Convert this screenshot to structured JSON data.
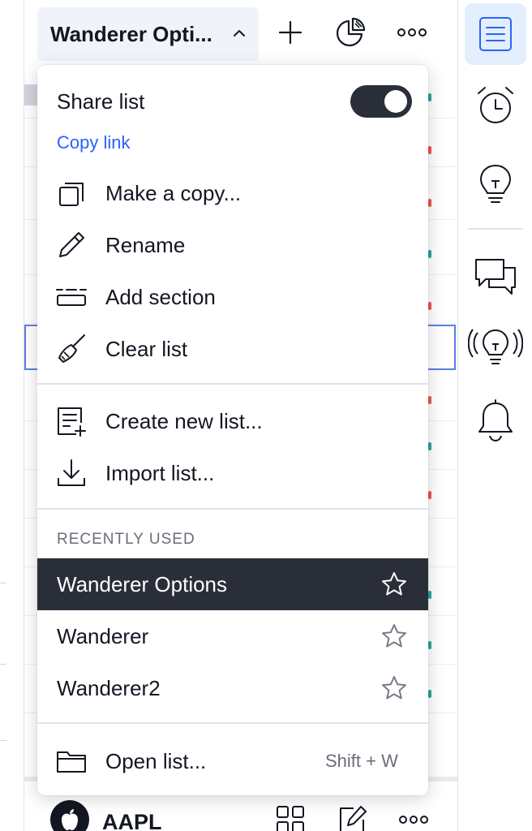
{
  "watchlist": {
    "title": "Wanderer Opti...",
    "symbol": "AAPL"
  },
  "menu": {
    "share_label": "Share list",
    "share_enabled": true,
    "copy_link": "Copy link",
    "items": [
      {
        "label": "Make a copy...",
        "icon": "copy-icon"
      },
      {
        "label": "Rename",
        "icon": "pencil-icon"
      },
      {
        "label": "Add section",
        "icon": "section-icon"
      },
      {
        "label": "Clear list",
        "icon": "broom-icon"
      }
    ],
    "items2": [
      {
        "label": "Create new list...",
        "icon": "new-list-icon"
      },
      {
        "label": "Import list...",
        "icon": "import-icon"
      }
    ],
    "recent_title": "RECENTLY USED",
    "recent": [
      {
        "label": "Wanderer Options",
        "selected": true
      },
      {
        "label": "Wanderer",
        "selected": false
      },
      {
        "label": "Wanderer2",
        "selected": false
      }
    ],
    "open_list": {
      "label": "Open list...",
      "shortcut": "Shift + W",
      "icon": "folder-icon"
    }
  },
  "right_bar": {
    "buttons": [
      "watchlist-icon",
      "alarm-clock-icon",
      "lightbulb-icon",
      "chat-icon",
      "broadcast-lightbulb-icon",
      "bell-icon"
    ]
  },
  "colors": {
    "accent": "#2962ff",
    "dark": "#2a2e39",
    "active_bg": "#e3effd"
  }
}
